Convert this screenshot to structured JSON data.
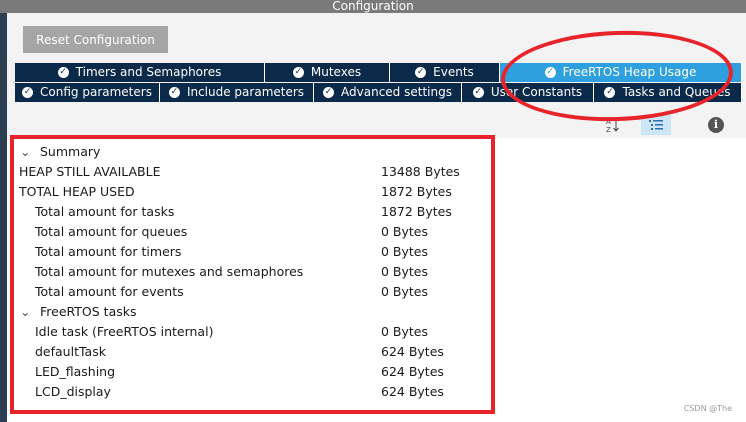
{
  "window": {
    "title": "Configuration"
  },
  "toolbar": {
    "reset_label": "Reset Configuration"
  },
  "tabs_row1": [
    {
      "label": "Timers and Semaphores"
    },
    {
      "label": "Mutexes"
    },
    {
      "label": "Events"
    },
    {
      "label": "FreeRTOS Heap Usage",
      "active": true
    }
  ],
  "tabs_row2": [
    {
      "label": "Config parameters"
    },
    {
      "label": "Include parameters"
    },
    {
      "label": "Advanced settings"
    },
    {
      "label": "User Constants"
    },
    {
      "label": "Tasks and Queues"
    }
  ],
  "tool_icons": [
    "sort-alpha-icon",
    "list-icon",
    "info-icon"
  ],
  "summary": {
    "section_label": "Summary",
    "rows": [
      {
        "label": "HEAP STILL AVAILABLE",
        "value": "13488  Bytes"
      },
      {
        "label": "TOTAL HEAP USED",
        "value": "1872  Bytes"
      },
      {
        "label": "Total amount for tasks",
        "value": "1872  Bytes"
      },
      {
        "label": "Total amount for queues",
        "value": "0  Bytes"
      },
      {
        "label": "Total amount for timers",
        "value": "0  Bytes"
      },
      {
        "label": "Total amount for mutexes and semaphores",
        "value": "0  Bytes"
      },
      {
        "label": "Total amount for events",
        "value": "0  Bytes"
      }
    ]
  },
  "tasks": {
    "section_label": "FreeRTOS tasks",
    "rows": [
      {
        "label": "Idle task (FreeRTOS internal)",
        "value": "0  Bytes"
      },
      {
        "label": "defaultTask",
        "value": "624  Bytes"
      },
      {
        "label": "LED_flashing",
        "value": "624  Bytes"
      },
      {
        "label": "LCD_display",
        "value": "624  Bytes"
      }
    ]
  },
  "watermark": "CSDN @The",
  "colors": {
    "tab_bg": "#0b2a4a",
    "tab_active": "#2ea0e0",
    "annotation_red": "#e8242a"
  }
}
